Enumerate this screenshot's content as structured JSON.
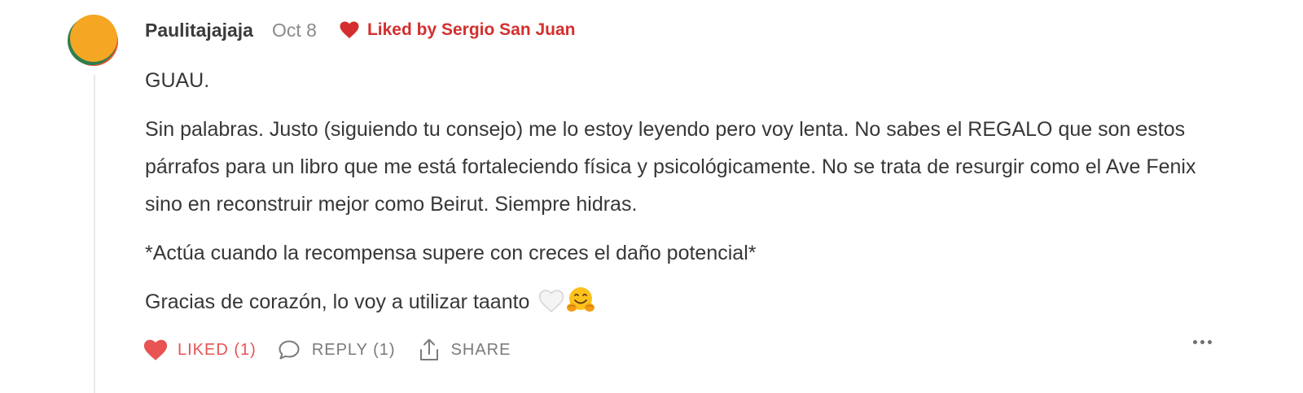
{
  "comment": {
    "author": "Paulitajajaja",
    "date": "Oct 8",
    "liked_by": "Liked by Sergio San Juan",
    "paragraphs": [
      "GUAU.",
      "Sin palabras. Justo (siguiendo tu consejo) me lo estoy leyendo pero voy lenta. No sabes el REGALO que son estos párrafos para un libro que me está fortaleciendo física y psicológicamente. No se trata de resurgir como el Ave Fenix sino en reconstruir mejor como Beirut. Siempre hidras.",
      "*Actúa cuando la recompensa supere con creces el daño potencial*",
      "Gracias de corazón, lo voy a utilizar taanto"
    ],
    "emojis": [
      "white-heart-emoji",
      "hugging-face-emoji"
    ],
    "avatar_colors": [
      "#f5a623",
      "#2e7d4f",
      "#e4572e"
    ]
  },
  "actions": {
    "like_label": "LIKED (1)",
    "reply_label": "REPLY (1)",
    "share_label": "SHARE",
    "more_icon": "more-horizontal-icon"
  },
  "colors": {
    "liked_red": "#e85353",
    "liked_by_red": "#d32f2f",
    "muted_gray": "#7a7a7a",
    "text": "#363737"
  }
}
